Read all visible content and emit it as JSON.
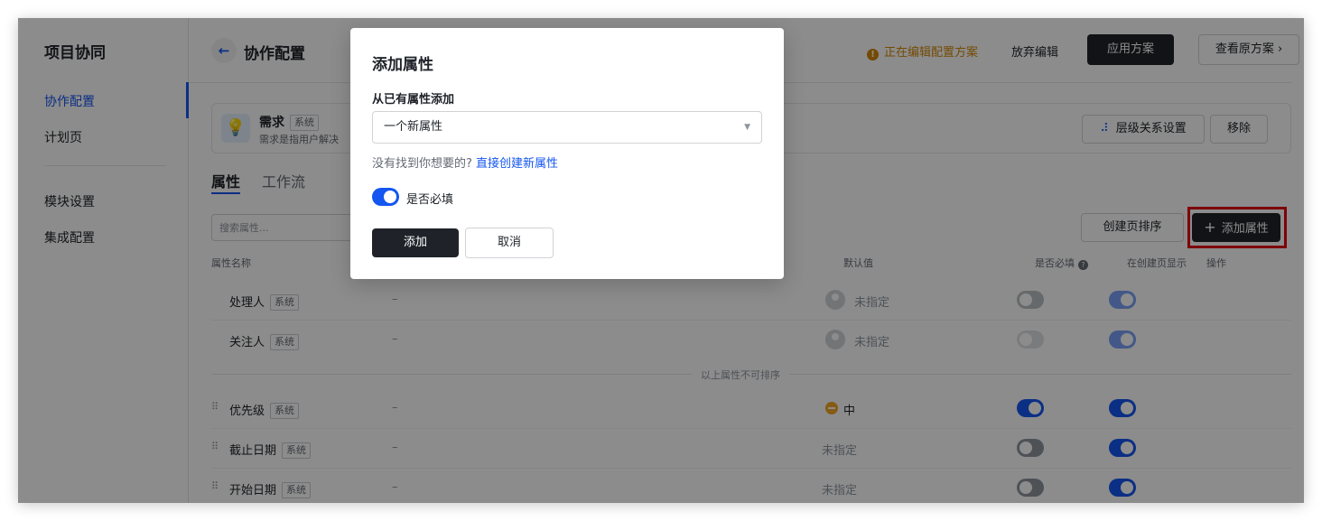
{
  "sidebar": {
    "title": "项目协同",
    "items": [
      {
        "label": "协作配置"
      },
      {
        "label": "计划页"
      },
      {
        "label": "模块设置"
      },
      {
        "label": "集成配置"
      }
    ]
  },
  "header": {
    "back_icon": "←",
    "title": "协作配置",
    "status_icon": "!",
    "status": "正在编辑配置方案",
    "discard": "放弃编辑",
    "apply": "应用方案",
    "view_original": "查看原方案 ›"
  },
  "type_card": {
    "icon": "💡",
    "name": "需求",
    "tag": "系统",
    "description": "需求是指用户解决",
    "hierarchy_icon": "⠼",
    "hierarchy": "层级关系设置",
    "remove": "移除"
  },
  "tabs": [
    {
      "label": "属性"
    },
    {
      "label": "工作流"
    }
  ],
  "toolbar": {
    "search_placeholder": "搜索属性...",
    "sort": "创建页排序",
    "add_icon": "+",
    "add": "添加属性"
  },
  "columns": {
    "name": "属性名称",
    "default": "默认值",
    "required": "是否必填",
    "help_icon": "?",
    "show": "在创建页显示",
    "actions": "操作"
  },
  "rows": [
    {
      "name": "处理人",
      "tag": "系统",
      "desc": "–",
      "default": "未指定",
      "required": false,
      "show": true
    },
    {
      "name": "关注人",
      "tag": "系统",
      "desc": "–",
      "default": "未指定",
      "required": false,
      "show": true
    },
    {
      "name": "优先级",
      "tag": "系统",
      "desc": "–",
      "default": "中",
      "required": true,
      "show": true
    },
    {
      "name": "截止日期",
      "tag": "系统",
      "desc": "–",
      "default": "未指定",
      "required": false,
      "show": true
    },
    {
      "name": "开始日期",
      "tag": "系统",
      "desc": "–",
      "default": "未指定",
      "required": false,
      "show": true
    }
  ],
  "separator": "以上属性不可排序",
  "drag_handle": "⠿",
  "modal": {
    "title": "添加属性",
    "label": "从已有属性添加",
    "select_value": "一个新属性",
    "select_caret": "▼",
    "hint": "没有找到你想要的?",
    "create_link": "直接创建新属性",
    "required_label": "是否必填",
    "required_on": true,
    "add": "添加",
    "cancel": "取消"
  },
  "colors": {
    "accent": "#1456f0",
    "warning": "#d48806",
    "primary_button": "#1f2329",
    "highlight": "#e60012"
  }
}
